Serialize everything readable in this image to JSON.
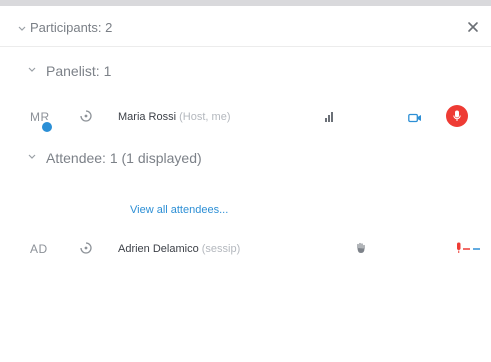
{
  "header": {
    "title": "Participants: 2"
  },
  "panelists": {
    "label": "Panelist: 1",
    "items": [
      {
        "initials": "MR",
        "name": "Maria Rossi",
        "suffix": "(Host, me)"
      }
    ]
  },
  "attendees": {
    "label": "Attendee: 1 (1 displayed)",
    "view_all_label": "View all attendees...",
    "items": [
      {
        "initials": "AD",
        "name": "Adrien Delamico",
        "suffix": "(sessip)"
      }
    ]
  },
  "colors": {
    "accent": "#2d8fd5",
    "mute_red": "#ee3b34",
    "status_blue": "#2b8fd6"
  },
  "icons": {
    "collapse": "chevron-down-icon",
    "close": "close-icon",
    "presence": "presence-icon",
    "signal": "signal-strength-icon",
    "video": "video-camera-icon",
    "mute": "microphone-mute-icon",
    "hand": "raise-hand-icon"
  }
}
